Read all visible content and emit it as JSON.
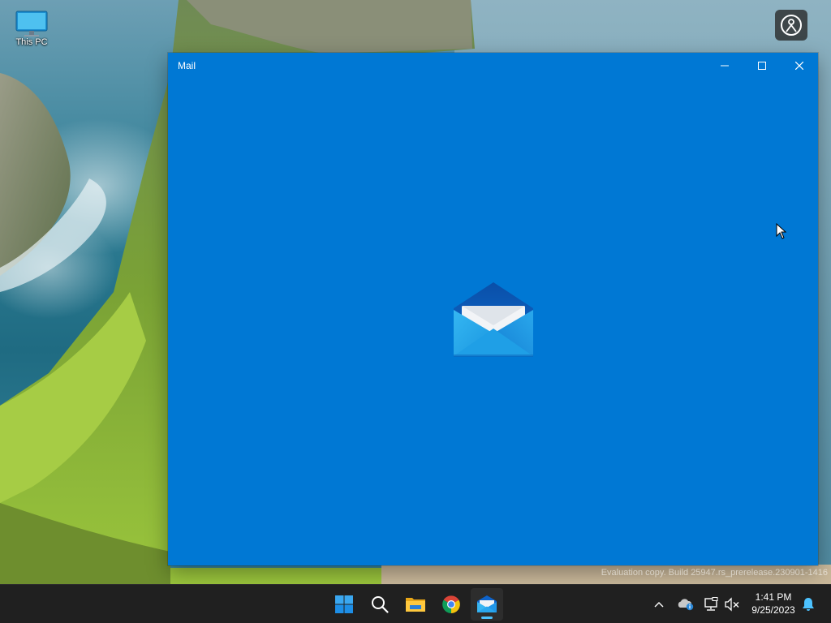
{
  "desktop": {
    "icons": [
      {
        "label": "This PC",
        "icon": "monitor-icon"
      }
    ]
  },
  "window": {
    "title": "Mail",
    "background_color": "#0078d4",
    "controls": [
      "minimize-icon",
      "maximize-icon",
      "close-icon"
    ],
    "splash_icon": "mail-envelope-icon"
  },
  "watermark": {
    "text": "Evaluation copy. Build 25947.rs_prerelease.230901-1416"
  },
  "taskbar": {
    "apps": [
      {
        "name": "Start",
        "icon": "windows-start-icon"
      },
      {
        "name": "Search",
        "icon": "search-icon"
      },
      {
        "name": "File Explorer",
        "icon": "folder-icon"
      },
      {
        "name": "Google Chrome",
        "icon": "chrome-icon"
      },
      {
        "name": "Mail",
        "icon": "mail-icon",
        "active": true
      }
    ],
    "tray": {
      "icons": [
        "chevron-up-icon",
        "onedrive-icon",
        "network-icon",
        "volume-muted-icon",
        "bell-icon"
      ],
      "time": "1:41 PM",
      "date": "9/25/2023"
    }
  }
}
